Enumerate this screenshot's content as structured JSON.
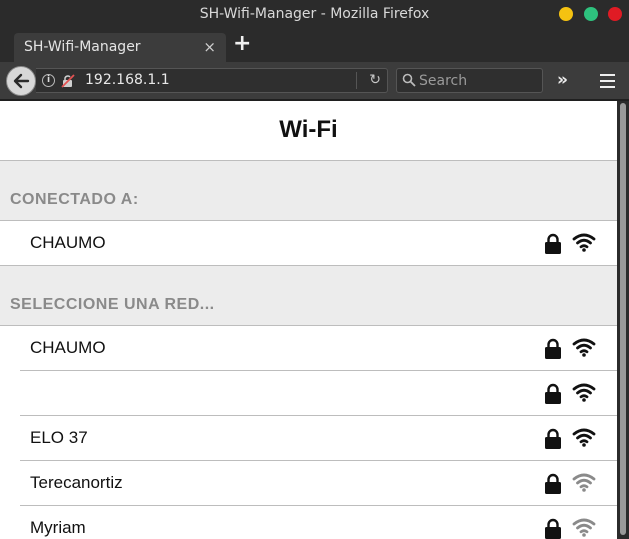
{
  "window": {
    "title": "SH-Wifi-Manager - Mozilla Firefox"
  },
  "tab": {
    "label": "SH-Wifi-Manager",
    "close": "×",
    "new_tab": "+"
  },
  "navbar": {
    "url": "192.168.1.1",
    "search_placeholder": "Search",
    "overflow": "»"
  },
  "page": {
    "title": "Wi-Fi",
    "connected_section": "CONECTADO A:",
    "connected": [
      {
        "ssid": "CHAUMO",
        "secured": true,
        "signal": "strong"
      }
    ],
    "select_section": "SELECCIONE UNA RED...",
    "networks": [
      {
        "ssid": "CHAUMO",
        "secured": true,
        "signal": "strong"
      },
      {
        "ssid": "",
        "secured": true,
        "signal": "strong"
      },
      {
        "ssid": "ELO 37",
        "secured": true,
        "signal": "strong"
      },
      {
        "ssid": "Terecanortiz",
        "secured": true,
        "signal": "weak"
      },
      {
        "ssid": "Myriam",
        "secured": true,
        "signal": "weak"
      }
    ]
  },
  "colors": {
    "wifi_strong": "#111111",
    "wifi_weak": "#8a8a8a",
    "section_bg": "#ececec",
    "section_text": "#8a8a8a"
  }
}
